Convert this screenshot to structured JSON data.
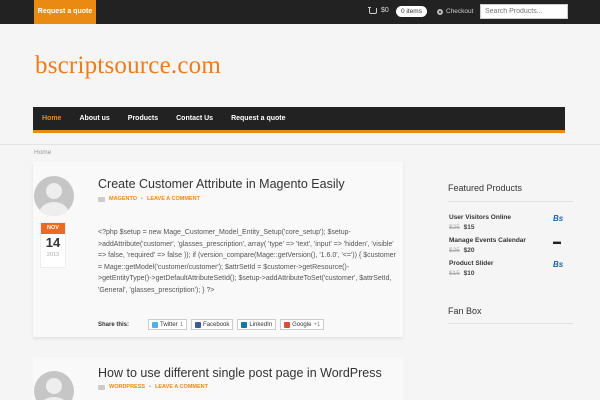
{
  "topbar": {
    "quote_button": "Request a quote",
    "cart_amount": "$0",
    "cart_items": "0 items",
    "checkout": "Checkout",
    "search_placeholder": "Search Products..."
  },
  "logo": "bscriptsource.com",
  "nav": [
    "Home",
    "About us",
    "Products",
    "Contact Us",
    "Request a quote"
  ],
  "breadcrumb": "Home",
  "posts": [
    {
      "title": "Create Customer Attribute in Magento Easily",
      "category": "MAGENTO",
      "comment": "LEAVE A COMMENT",
      "date": {
        "month": "NOV",
        "day": "14",
        "year": "2013"
      },
      "excerpt": "<?php $setup = new Mage_Customer_Model_Entity_Setup('core_setup'); $setup->addAttribute('customer', 'glasses_prescription', array( 'type'      => 'text', 'input'      => 'hidden', 'visible'  => false, 'required' => false )); if (version_compare(Mage::getVersion(), '1.6.0', '<=')) { $customer = Mage::getModel('customer/customer'); $attrSetId = $customer->getResource()->getEntityType()->getDefaultAttributeSetId(); $setup->addAttributeToSet('customer', $attrSetId, 'General', 'glasses_prescription'); } ?>",
      "share_label": "Share this:",
      "share": [
        "Twitter",
        "Facebook",
        "LinkedIn",
        "Google"
      ],
      "twitter_count": "1",
      "google_count": "+1"
    },
    {
      "title": "How to use different single post page in WordPress",
      "category": "WORDPRESS",
      "comment": "LEAVE A COMMENT"
    }
  ],
  "sidebar": {
    "featured_title": "Featured Products",
    "products": [
      {
        "name": "User Visitors Online",
        "old_price": "$25",
        "price": "$15",
        "thumb": "Bs"
      },
      {
        "name": "Manage Events Calendar",
        "old_price": "$25",
        "price": "$20",
        "thumb": ""
      },
      {
        "name": "Product Slider",
        "old_price": "$15",
        "price": "$10",
        "thumb": "Bs"
      }
    ],
    "fanbox_title": "Fan Box"
  },
  "colors": {
    "accent": "#ea8a12",
    "dark": "#222222",
    "date_tab": "#ec6a22"
  }
}
